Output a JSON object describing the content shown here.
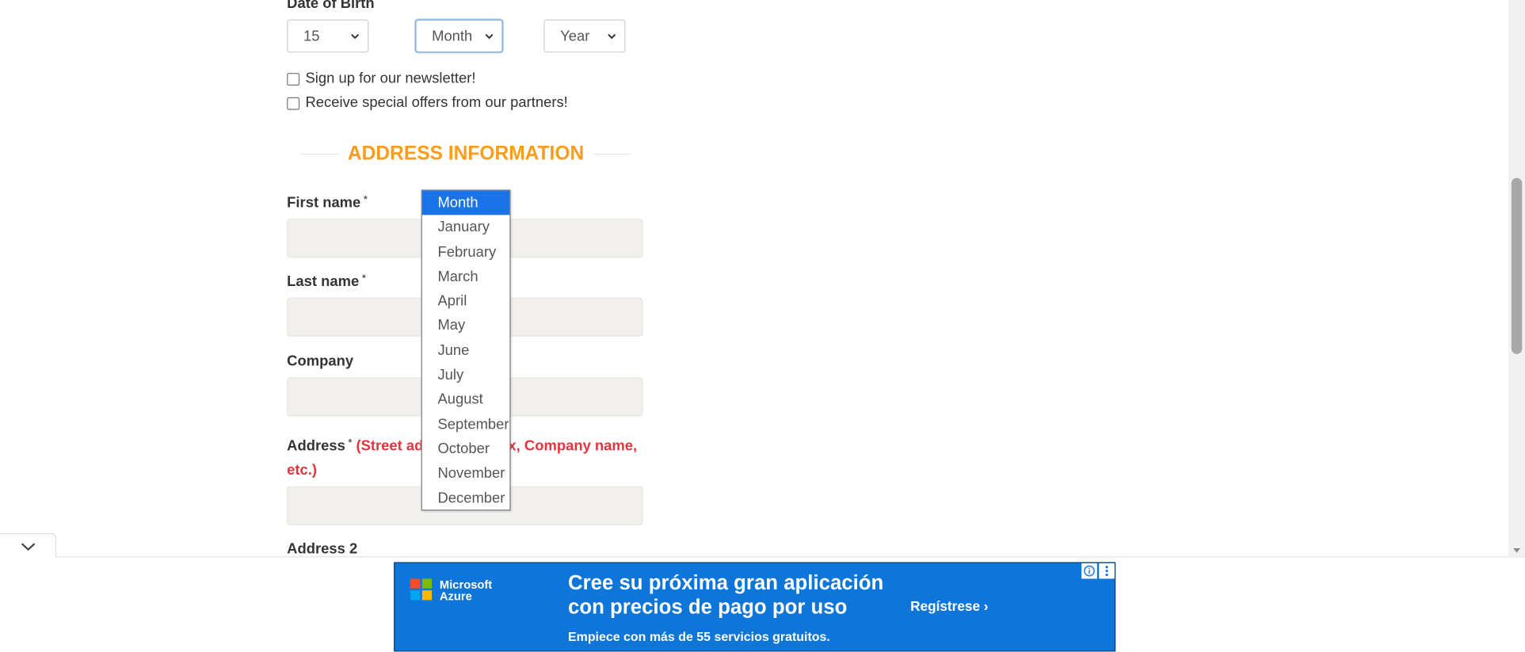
{
  "dob": {
    "label": "Date of Birth",
    "day_value": "15",
    "month_value": "Month",
    "year_value": "Year"
  },
  "checkboxes": {
    "newsletter": "Sign up for our newsletter!",
    "partners": "Receive special offers from our partners!"
  },
  "section": {
    "title": "ADDRESS INFORMATION"
  },
  "fields": {
    "first_name": "First name",
    "last_name": "Last name",
    "company": "Company",
    "address": "Address",
    "address_note_start": "(Street add",
    "address_note_end": "x, Company name,",
    "address_note_line2": "etc.)",
    "address2": "Address 2",
    "required_mark": "*"
  },
  "month_dropdown": {
    "options": [
      "Month",
      "January",
      "February",
      "March",
      "April",
      "May",
      "June",
      "July",
      "August",
      "September",
      "October",
      "November",
      "December"
    ],
    "selected": "Month"
  },
  "ad": {
    "brand_line1": "Microsoft",
    "brand_line2": "Azure",
    "headline_line1": "Cree su próxima gran aplicación",
    "headline_line2": "con precios de pago por uso",
    "subtext": "Empiece con más de 55 servicios gratuitos.",
    "cta": "Regístrese ›"
  },
  "colors": {
    "section_title": "#f89c1c",
    "address_note": "#e8323c",
    "dropdown_selected": "#1a73e8",
    "ad_background": "#0f76d9",
    "input_background": "#f1f0ec"
  }
}
